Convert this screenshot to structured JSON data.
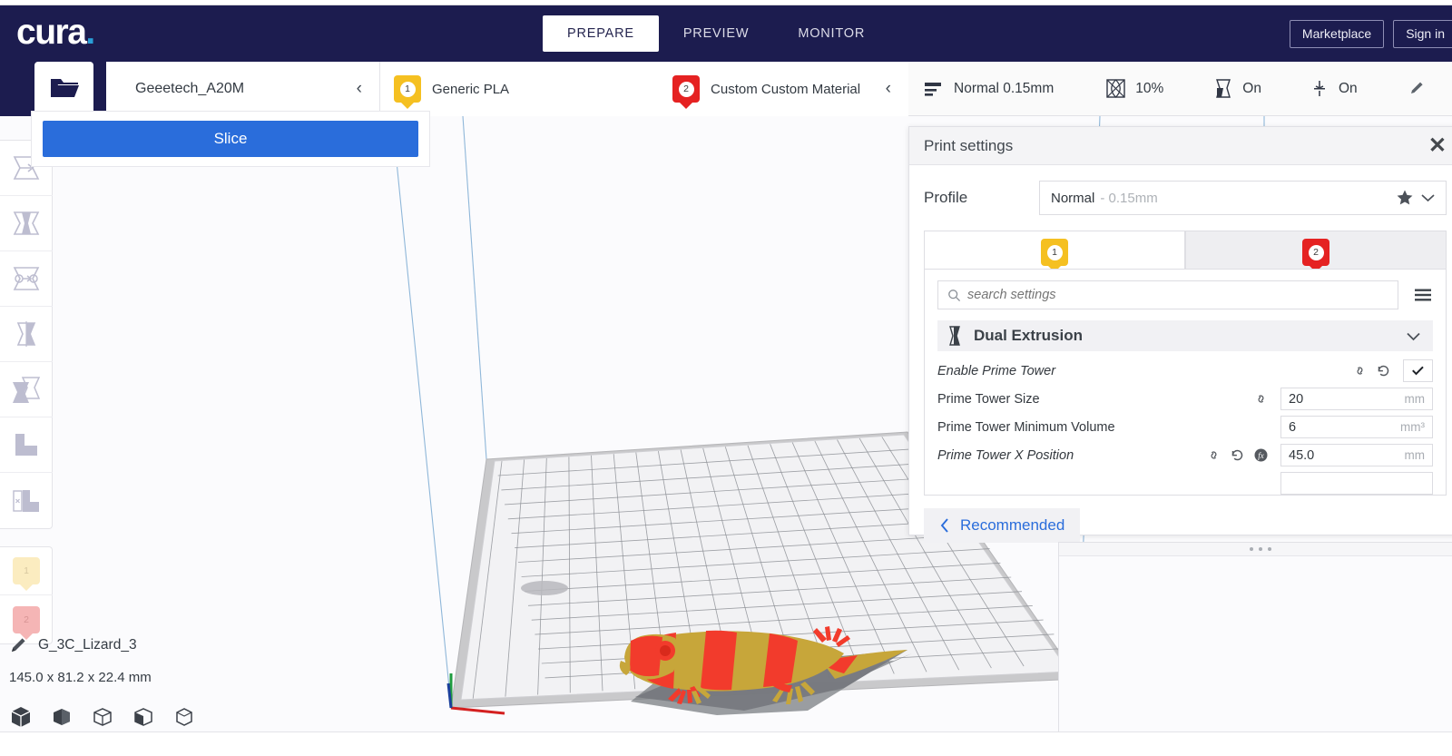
{
  "app": {
    "logo_text": "cura",
    "logo_dot": "."
  },
  "appbar": {
    "stages": [
      {
        "label": "PREPARE",
        "active": true
      },
      {
        "label": "PREVIEW",
        "active": false
      },
      {
        "label": "MONITOR",
        "active": false
      }
    ],
    "marketplace_label": "Marketplace",
    "signin_label": "Sign in"
  },
  "selectors": {
    "open_file_icon": "open-folder-icon",
    "machine": {
      "name": "Geeetech_A20M",
      "chevron": "‹"
    },
    "materials": {
      "chevron": "‹",
      "extruders": [
        {
          "number": "1",
          "name": "Generic PLA",
          "color": "#f5c021"
        },
        {
          "number": "2",
          "name": "Custom Custom Material",
          "color": "#e52222"
        }
      ]
    }
  },
  "summary": {
    "profile": "Normal 0.15mm",
    "infill": "10%",
    "support": "On",
    "adhesion": "On",
    "edit_icon": "pencil-icon"
  },
  "tools": {
    "items": [
      {
        "name": "move-tool",
        "icon": "move-icon"
      },
      {
        "name": "scale-tool",
        "icon": "scale-icon"
      },
      {
        "name": "rotate-tool",
        "icon": "rotate-icon"
      },
      {
        "name": "mirror-tool",
        "icon": "mirror-icon"
      },
      {
        "name": "per-model-settings-tool",
        "icon": "per-model-icon"
      },
      {
        "name": "support-blocker-tool",
        "icon": "support-blocker-icon"
      },
      {
        "name": "support-eraser-tool",
        "icon": "support-eraser-icon"
      }
    ],
    "extruder_buttons": [
      {
        "number": "1",
        "color": "#fbecc0"
      },
      {
        "number": "2",
        "color": "#f5b5b5"
      }
    ]
  },
  "model": {
    "name": "G_3C_Lizard_3",
    "dimensions": "145.0 x 81.2 x 22.4 mm",
    "edit_icon": "pencil-icon",
    "view_cubes": [
      "view-solid-cube",
      "view-shaded-cube",
      "view-outline-cube",
      "view-partial-cube",
      "view-wire-cube"
    ]
  },
  "print_settings": {
    "title": "Print settings",
    "close_label": "✕",
    "profile_label": "Profile",
    "profile_value": "Normal",
    "profile_sub": "- 0.15mm",
    "favorite_icon": "star-icon",
    "dropdown_icon": "chevron-down-icon",
    "extruder_tabs": [
      {
        "number": "1",
        "color": "#f5c021",
        "active": true
      },
      {
        "number": "2",
        "color": "#e52222",
        "active": false
      }
    ],
    "search_placeholder": "search settings",
    "search_value": "",
    "menu_icon": "hamburger-icon",
    "category": {
      "icon": "dual-extrusion-icon",
      "title": "Dual Extrusion",
      "chevron": "chevron-down-icon"
    },
    "rows": [
      {
        "label": "Enable Prime Tower",
        "italic": true,
        "icons": [
          "link-icon",
          "revert-icon"
        ],
        "type": "checkbox",
        "checked": true,
        "value": "",
        "unit": ""
      },
      {
        "label": "Prime Tower Size",
        "italic": false,
        "icons": [
          "link-icon"
        ],
        "type": "text",
        "value": "20",
        "unit": "mm"
      },
      {
        "label": "Prime Tower Minimum Volume",
        "italic": false,
        "icons": [],
        "type": "text",
        "value": "6",
        "unit": "mm³"
      },
      {
        "label": "Prime Tower X Position",
        "italic": true,
        "icons": [
          "link-icon",
          "revert-icon",
          "function-icon"
        ],
        "type": "text",
        "value": "45.0",
        "unit": "mm"
      }
    ],
    "recommended_label": "Recommended",
    "recommended_chevron": "‹"
  },
  "actions": {
    "slice_label": "Slice"
  },
  "colors": {
    "navy": "#1c1c4f",
    "accent_blue": "#2a6ddb",
    "logo_dot": "#2a9fd8",
    "extruder1": "#f5c021",
    "extruder2": "#e52222",
    "model_red": "#f23b2c",
    "model_gold": "#c7a63a",
    "scrollbar": "#14144a"
  }
}
